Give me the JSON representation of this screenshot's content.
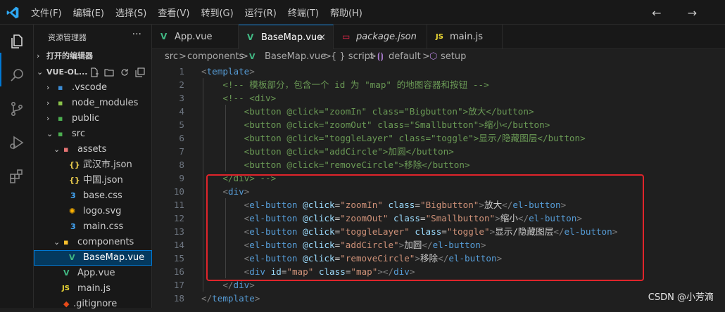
{
  "menu": [
    "文件(F)",
    "编辑(E)",
    "选择(S)",
    "查看(V)",
    "转到(G)",
    "运行(R)",
    "终端(T)",
    "帮助(H)"
  ],
  "nav_arrows": "← →",
  "sidebar": {
    "title": "资源管理器",
    "more": "···",
    "open_editors": "打开的编辑器",
    "project": "VUE-OL...",
    "items": [
      {
        "label": ".vscode",
        "icon": "›"
      },
      {
        "label": "node_modules",
        "icon": "›"
      },
      {
        "label": "public",
        "icon": "›"
      },
      {
        "label": "src",
        "icon": "⌄"
      },
      {
        "label": "assets",
        "icon": "⌄"
      },
      {
        "label": "武汉市.json",
        "icon": "{}"
      },
      {
        "label": "中国.json",
        "icon": "{}"
      },
      {
        "label": "base.css",
        "icon": "3"
      },
      {
        "label": "logo.svg",
        "icon": "✺"
      },
      {
        "label": "main.css",
        "icon": "3"
      },
      {
        "label": "components",
        "icon": "⌄"
      },
      {
        "label": "BaseMap.vue",
        "icon": "V"
      },
      {
        "label": "App.vue",
        "icon": "V"
      },
      {
        "label": "main.js",
        "icon": "JS"
      },
      {
        "label": ".gitignore",
        "icon": "◆"
      }
    ]
  },
  "tabs": [
    {
      "label": "App.vue",
      "icon": "V",
      "color": "#41b883"
    },
    {
      "label": "BaseMap.vue",
      "icon": "V",
      "color": "#41b883",
      "close": "×"
    },
    {
      "label": "package.json",
      "icon": "▭",
      "color": "#e8274b"
    },
    {
      "label": "main.js",
      "icon": "JS",
      "color": "#f1dd35"
    }
  ],
  "breadcrumb": {
    "parts": [
      "src",
      ">",
      "components",
      ">",
      "BaseMap.vue",
      ">",
      "{ } script",
      ">",
      "default",
      ">",
      "setup"
    ]
  },
  "line_numbers": [
    "1",
    "2",
    "3",
    "4",
    "5",
    "6",
    "7",
    "8",
    "9",
    "10",
    "11",
    "12",
    "13",
    "14",
    "15",
    "16",
    "17",
    "18"
  ],
  "code_lines": [
    [
      [
        "t-punct",
        "<"
      ],
      [
        "t-tag",
        "template"
      ],
      [
        "t-punct",
        ">"
      ]
    ],
    [
      [
        "t-cmt",
        "    <!-- 模板部分，包含一个 id 为 \"map\" 的地图容器和按钮 -->"
      ]
    ],
    [
      [
        "t-cmt",
        "    <!-- <div>"
      ]
    ],
    [
      [
        "t-cmt",
        "        <button @click=\"zoomIn\" class=\"Bigbutton\">放大</button>"
      ]
    ],
    [
      [
        "t-cmt",
        "        <button @click=\"zoomOut\" class=\"Smallbutton\">缩小</button>"
      ]
    ],
    [
      [
        "t-cmt",
        "        <button @click=\"toggleLayer\" class=\"toggle\">显示/隐藏图层</button>"
      ]
    ],
    [
      [
        "t-cmt",
        "        <button @click=\"addCircle\">加圆</button>"
      ]
    ],
    [
      [
        "t-cmt",
        "        <button @click=\"removeCircle\">移除</button>"
      ]
    ],
    [
      [
        "t-cmt",
        "    </div> -->"
      ]
    ],
    [
      [
        "t-txt",
        "    "
      ],
      [
        "t-punct",
        "<"
      ],
      [
        "t-tag",
        "div"
      ],
      [
        "t-punct",
        ">"
      ]
    ],
    [
      [
        "t-txt",
        "        "
      ],
      [
        "t-punct",
        "<"
      ],
      [
        "t-tag",
        "el-button"
      ],
      [
        "t-txt",
        " "
      ],
      [
        "t-attr",
        "@click"
      ],
      [
        "t-txt",
        "="
      ],
      [
        "t-str",
        "\"zoomIn\""
      ],
      [
        "t-txt",
        " "
      ],
      [
        "t-attr",
        "class"
      ],
      [
        "t-txt",
        "="
      ],
      [
        "t-str",
        "\"Bigbutton\""
      ],
      [
        "t-punct",
        ">"
      ],
      [
        "t-txt",
        "放大"
      ],
      [
        "t-punct",
        "</"
      ],
      [
        "t-tag",
        "el-button"
      ],
      [
        "t-punct",
        ">"
      ]
    ],
    [
      [
        "t-txt",
        "        "
      ],
      [
        "t-punct",
        "<"
      ],
      [
        "t-tag",
        "el-button"
      ],
      [
        "t-txt",
        " "
      ],
      [
        "t-attr",
        "@click"
      ],
      [
        "t-txt",
        "="
      ],
      [
        "t-str",
        "\"zoomOut\""
      ],
      [
        "t-txt",
        " "
      ],
      [
        "t-attr",
        "class"
      ],
      [
        "t-txt",
        "="
      ],
      [
        "t-str",
        "\"Smallbutton\""
      ],
      [
        "t-punct",
        ">"
      ],
      [
        "t-txt",
        "缩小"
      ],
      [
        "t-punct",
        "</"
      ],
      [
        "t-tag",
        "el-button"
      ],
      [
        "t-punct",
        ">"
      ]
    ],
    [
      [
        "t-txt",
        "        "
      ],
      [
        "t-punct",
        "<"
      ],
      [
        "t-tag",
        "el-button"
      ],
      [
        "t-txt",
        " "
      ],
      [
        "t-attr",
        "@click"
      ],
      [
        "t-txt",
        "="
      ],
      [
        "t-str",
        "\"toggleLayer\""
      ],
      [
        "t-txt",
        " "
      ],
      [
        "t-attr",
        "class"
      ],
      [
        "t-txt",
        "="
      ],
      [
        "t-str",
        "\"toggle\""
      ],
      [
        "t-punct",
        ">"
      ],
      [
        "t-txt",
        "显示/隐藏图层"
      ],
      [
        "t-punct",
        "</"
      ],
      [
        "t-tag",
        "el-button"
      ],
      [
        "t-punct",
        ">"
      ]
    ],
    [
      [
        "t-txt",
        "        "
      ],
      [
        "t-punct",
        "<"
      ],
      [
        "t-tag",
        "el-button"
      ],
      [
        "t-txt",
        " "
      ],
      [
        "t-attr",
        "@click"
      ],
      [
        "t-txt",
        "="
      ],
      [
        "t-str",
        "\"addCircle\""
      ],
      [
        "t-punct",
        ">"
      ],
      [
        "t-txt",
        "加圆"
      ],
      [
        "t-punct",
        "</"
      ],
      [
        "t-tag",
        "el-button"
      ],
      [
        "t-punct",
        ">"
      ]
    ],
    [
      [
        "t-txt",
        "        "
      ],
      [
        "t-punct",
        "<"
      ],
      [
        "t-tag",
        "el-button"
      ],
      [
        "t-txt",
        " "
      ],
      [
        "t-attr",
        "@click"
      ],
      [
        "t-txt",
        "="
      ],
      [
        "t-str",
        "\"removeCircle\""
      ],
      [
        "t-punct",
        ">"
      ],
      [
        "t-txt",
        "移除"
      ],
      [
        "t-punct",
        "</"
      ],
      [
        "t-tag",
        "el-button"
      ],
      [
        "t-punct",
        ">"
      ]
    ],
    [
      [
        "t-txt",
        "        "
      ],
      [
        "t-punct",
        "<"
      ],
      [
        "t-tag",
        "div"
      ],
      [
        "t-txt",
        " "
      ],
      [
        "t-attr",
        "id"
      ],
      [
        "t-txt",
        "="
      ],
      [
        "t-str",
        "\"map\""
      ],
      [
        "t-txt",
        " "
      ],
      [
        "t-attr",
        "class"
      ],
      [
        "t-txt",
        "="
      ],
      [
        "t-str",
        "\"map\""
      ],
      [
        "t-punct",
        "></"
      ],
      [
        "t-tag",
        "div"
      ],
      [
        "t-punct",
        ">"
      ]
    ],
    [
      [
        "t-txt",
        "    "
      ],
      [
        "t-punct",
        "</"
      ],
      [
        "t-tag",
        "div"
      ],
      [
        "t-punct",
        ">"
      ]
    ],
    [
      [
        "t-punct",
        "</"
      ],
      [
        "t-tag",
        "template"
      ],
      [
        "t-punct",
        ">"
      ]
    ]
  ],
  "watermark": "CSDN @小芳滴",
  "colors": {
    "accent": "#0078d4",
    "highlight_box": "#e0242b",
    "vue": "#41b883"
  }
}
